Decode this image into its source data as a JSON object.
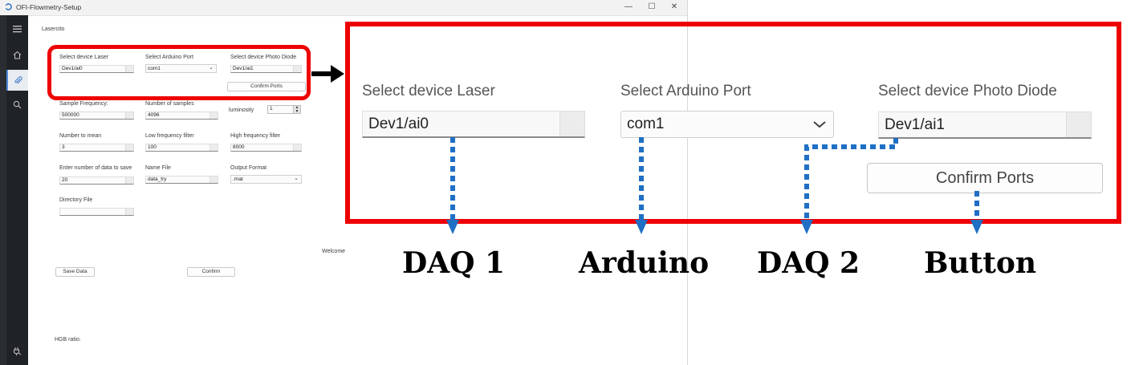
{
  "window": {
    "title": "OFI-Flowmetry-Setup",
    "controls": {
      "minimize": "—",
      "maximize": "☐",
      "close": "✕"
    }
  },
  "sidebar": {
    "items": [
      {
        "icon": "hamburger-menu-icon"
      },
      {
        "icon": "home-icon"
      },
      {
        "icon": "attachment-icon",
        "active": true
      },
      {
        "icon": "search-icon"
      },
      {
        "icon": "plug-icon"
      }
    ]
  },
  "app": {
    "section_title": "Lasercito",
    "ports": {
      "laser_label": "Select device Laser",
      "laser_value": "Dev1/ai0",
      "arduino_label": "Select Arduino Port",
      "arduino_value": "com1",
      "photodiode_label": "Select device Photo Diode",
      "photodiode_value": "Dev1/ai1",
      "confirm_ports": "Confirm Ports"
    },
    "params": {
      "sample_freq_label": "Sample Frequency:",
      "sample_freq_value": "500000",
      "num_samples_label": "Number of samples",
      "num_samples_value": "4096",
      "luminosity_label": "luminosity",
      "luminosity_value": "1",
      "num_mean_label": "Number to mean",
      "num_mean_value": "3",
      "low_filter_label": "Low frequency filter",
      "low_filter_value": "100",
      "high_filter_label": "High frequency filter",
      "high_filter_value": "8000",
      "num_save_label": "Enter number of data to save",
      "num_save_value": "20",
      "name_file_label": "Name File",
      "name_file_value": "data_try",
      "output_format_label": "Output Format",
      "output_format_value": ".mat",
      "directory_label": "Directory File",
      "directory_value": ""
    },
    "welcome": "Welcome",
    "save_data": "Save Data",
    "confirm": "Confirm",
    "hgb_ratio": "HGB ratio:"
  },
  "zoom": {
    "laser_label": "Select device Laser",
    "laser_value": "Dev1/ai0",
    "arduino_label": "Select Arduino Port",
    "arduino_value": "com1",
    "photodiode_label": "Select device Photo Diode",
    "photodiode_value": "Dev1/ai1",
    "confirm_ports": "Confirm Ports"
  },
  "annotations": {
    "daq1": "DAQ 1",
    "arduino": "Arduino",
    "daq2": "DAQ 2",
    "button": "Button"
  },
  "colors": {
    "highlight_red": "#ee0000",
    "connector_blue": "#1f6fc4",
    "sidebar_dark": "#1f2226"
  }
}
